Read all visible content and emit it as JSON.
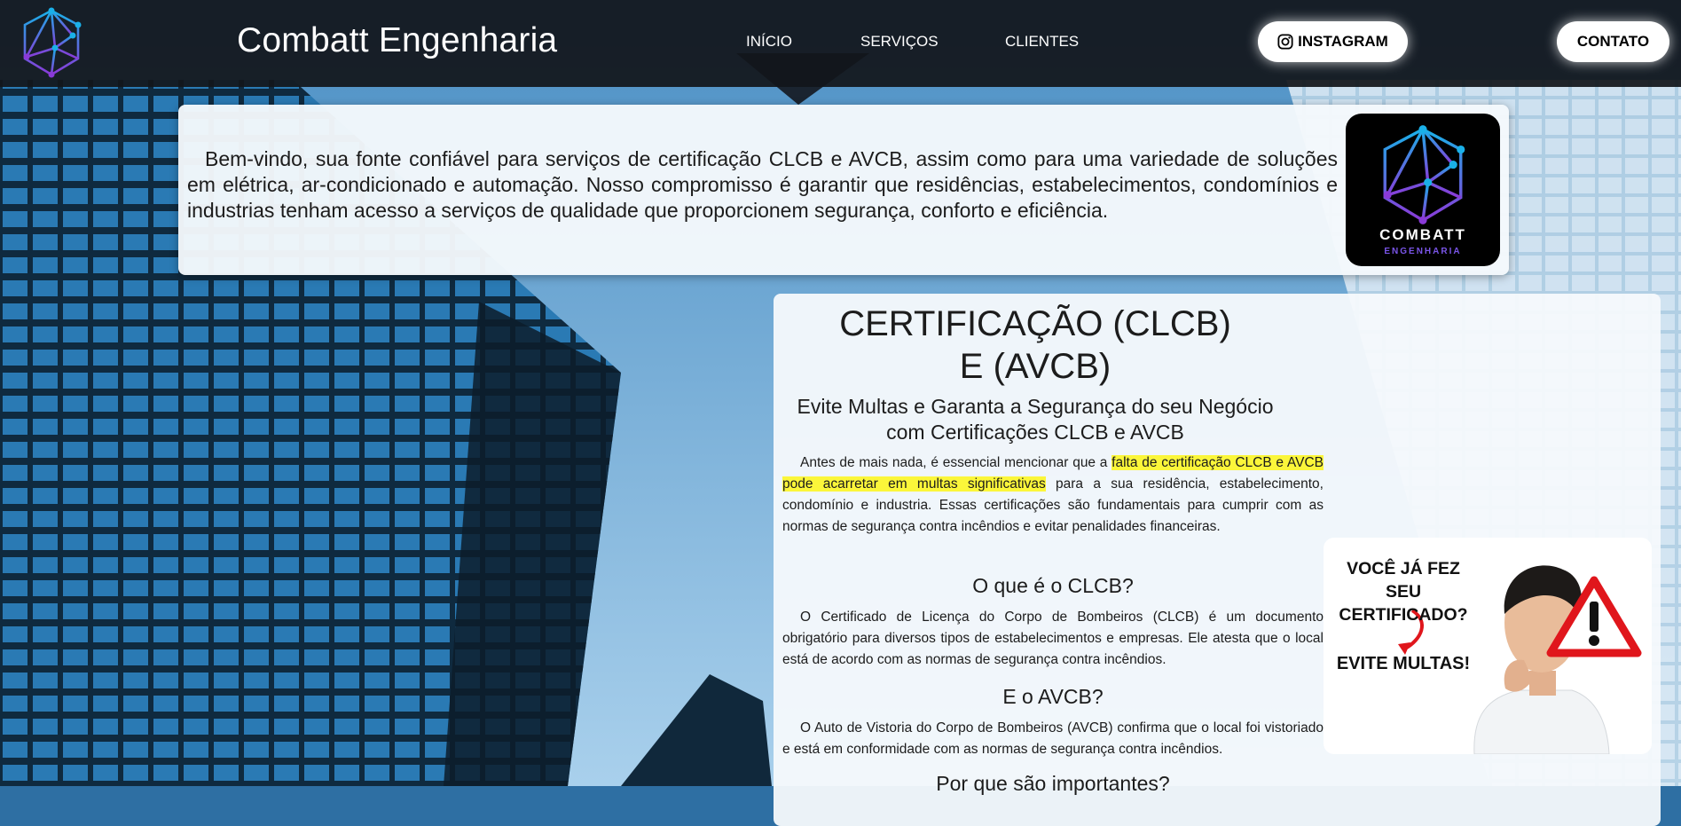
{
  "header": {
    "brand": "Combatt Engenharia",
    "nav": [
      "INÍCIO",
      "SERVIÇOS",
      "CLIENTES"
    ],
    "instagram_label": "INSTAGRAM",
    "contact_label": "CONTATO"
  },
  "intro": {
    "text": "Bem-vindo, sua fonte confiável para serviços de certificação CLCB e AVCB, assim como para uma variedade de soluções em elétrica, ar-condicionado e automação. Nosso compromisso é garantir que residências, estabelecimentos, condomínios e industrias tenham acesso a serviços de qualidade que proporcionem segurança, conforto e eficiência.",
    "logo_line1": "COMBATT",
    "logo_line2": "ENGENHARIA"
  },
  "certification": {
    "title": "CERTIFICAÇÃO (CLCB) E (AVCB)",
    "subtitle": "Evite Multas e Garanta a Segurança do seu Negócio com Certificações CLCB e AVCB",
    "intro_before": "Antes de mais nada, é essencial mencionar que a ",
    "intro_highlight": "falta de certificação CLCB e AVCB pode acarretar em multas significativas",
    "intro_after": " para a sua residência, estabelecimento, condomínio e industria. Essas certificações são fundamentais para cumprir com as normas de segurança contra incêndios e evitar penalidades financeiras.",
    "clcb_heading": "O que é o CLCB?",
    "clcb_text": "O Certificado de Licença do Corpo de Bombeiros (CLCB) é um documento obrigatório para diversos tipos de estabelecimentos e empresas. Ele atesta que o local está de acordo com as normas de segurança contra incêndios.",
    "avcb_heading": "E o AVCB?",
    "avcb_text": "O Auto de Vistoria do Corpo de Bombeiros (AVCB) confirma que o local foi vistoriado e está em conformidade com as normas de segurança contra incêndios.",
    "why_heading": "Por que são importantes?"
  },
  "promo": {
    "line1": "VOCÊ JÁ FEZ SEU CERTIFICADO?",
    "line2": "EVITE MULTAS!"
  },
  "colors": {
    "topbar": "#12161b",
    "highlight": "#fbf63a",
    "logo_gradient_start": "#1ab0e8",
    "logo_gradient_end": "#8a3ad8",
    "warning_red": "#e0161c"
  },
  "icons": [
    "combatt-logo-icon",
    "instagram-icon",
    "warning-icon"
  ]
}
